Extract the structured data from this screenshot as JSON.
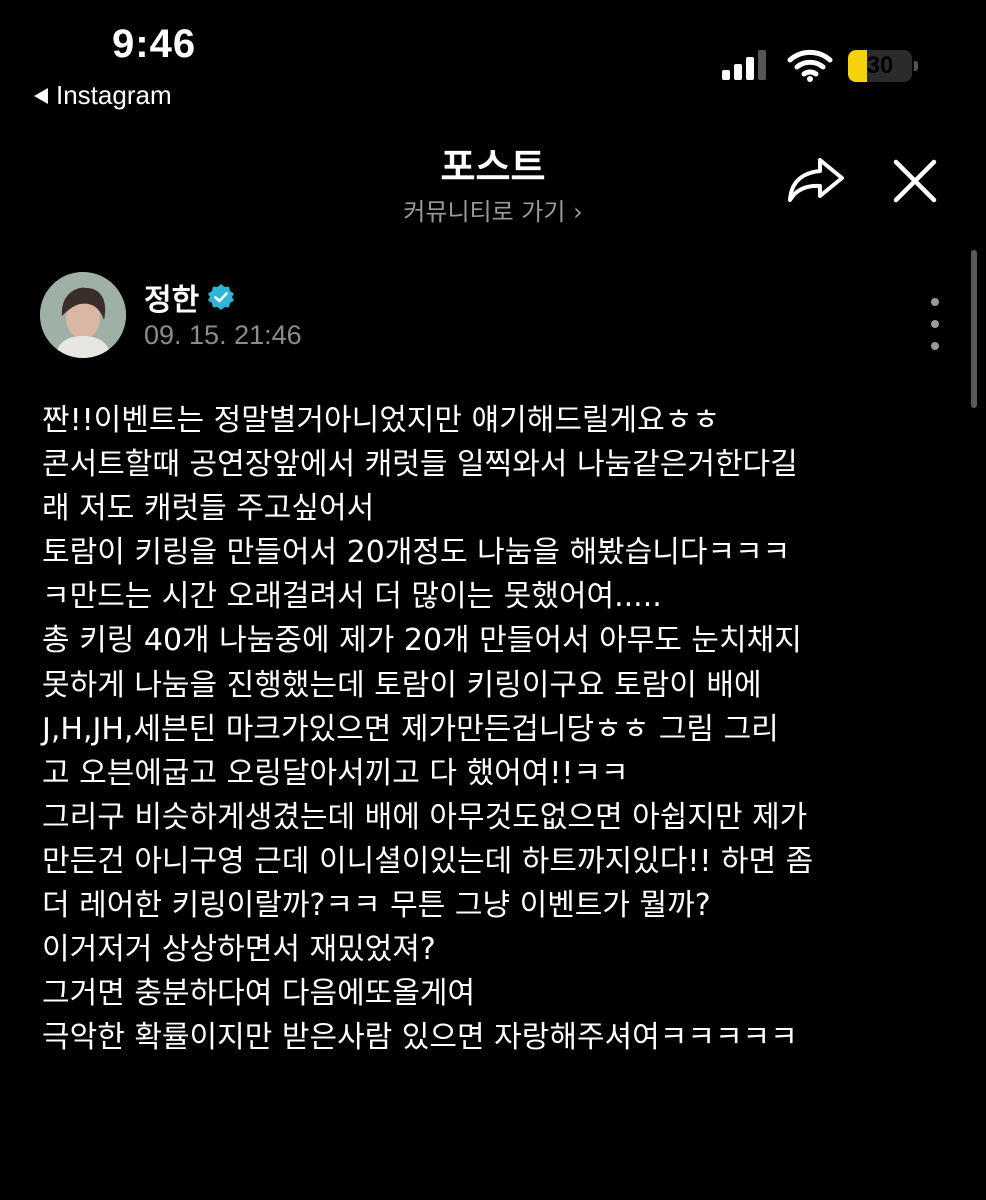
{
  "status_bar": {
    "time": "9:46",
    "back_app": "Instagram",
    "battery_level": "30",
    "battery_fraction": 0.3
  },
  "header": {
    "title": "포스트",
    "community_link": "커뮤니티로 가기 ›"
  },
  "author": {
    "name": "정한",
    "verified": true,
    "timestamp": "09. 15. 21:46"
  },
  "post": {
    "lines": [
      "짠!!이벤트는 정말별거아니었지만 얘기해드릴게요ㅎㅎ",
      "콘서트할때 공연장앞에서 캐럿들 일찍와서 나눔같은거한다길",
      "래 저도 캐럿들 주고싶어서",
      "토람이 키링을 만들어서 20개정도 나눔을 해봤습니다ㅋㅋㅋ",
      "ㅋ만드는 시간 오래걸려서 더 많이는 못했어여.....",
      "총 키링 40개 나눔중에 제가 20개 만들어서 아무도 눈치채지",
      "못하게 나눔을 진행했는데 토람이 키링이구요 토람이 배에",
      "J,H,JH,세븐틴 마크가있으면 제가만든겁니당ㅎㅎ 그림 그리",
      "고 오븐에굽고 오링달아서끼고 다 했어여!!ㅋㅋ",
      "그리구 비슷하게생겼는데 배에 아무것도없으면 아쉽지만 제가",
      "만든건 아니구영 근데 이니셜이있는데 하트까지있다!! 하면 좀",
      "더 레어한 키링이랄까?ㅋㅋ 무튼 그냥 이벤트가 뭘까?",
      "이거저거 상상하면서 재밌었져?",
      "그거면 충분하다여 다음에또올게여",
      "극악한 확률이지만 받은사람 있으면 자랑해주셔여ㅋㅋㅋㅋㅋ"
    ]
  },
  "icons": {
    "share": "share-arrow-icon",
    "close": "close-icon",
    "more": "more-vertical-icon",
    "verified": "verified-badge-icon",
    "back": "back-triangle-icon"
  },
  "colors": {
    "background": "#000000",
    "text": "#ffffff",
    "secondary_text": "#9a9a9a",
    "verified_badge": "#2fb6d6",
    "battery": "#f5d20d"
  }
}
